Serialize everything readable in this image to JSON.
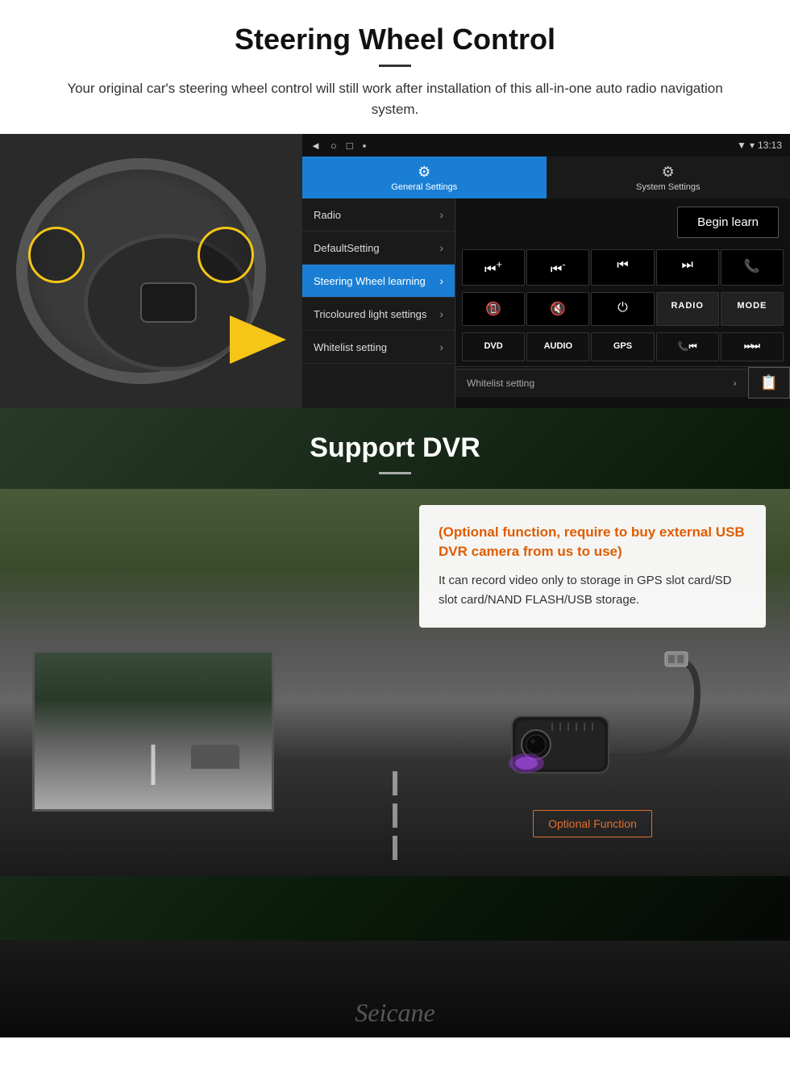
{
  "steering_section": {
    "title": "Steering Wheel Control",
    "description": "Your original car's steering wheel control will still work after installation of this all-in-one auto radio navigation system.",
    "statusbar": {
      "nav_back": "◄",
      "nav_home": "○",
      "nav_recent": "□",
      "nav_menu": "▪",
      "time": "13:13",
      "signal_icon": "▼",
      "wifi_icon": "▾"
    },
    "tabs": {
      "general": {
        "icon": "⚙",
        "label": "General Settings"
      },
      "system": {
        "icon": "⚙",
        "label": "System Settings"
      }
    },
    "menu_items": [
      {
        "label": "Radio",
        "active": false
      },
      {
        "label": "DefaultSetting",
        "active": false
      },
      {
        "label": "Steering Wheel learning",
        "active": true
      },
      {
        "label": "Tricoloured light settings",
        "active": false
      },
      {
        "label": "Whitelist setting",
        "active": false
      }
    ],
    "begin_learn_label": "Begin learn",
    "control_buttons_row1": [
      "⏮+",
      "⏮-",
      "⏮",
      "⏭",
      "📞"
    ],
    "control_buttons_row2": [
      "📵",
      "🔇",
      "⏻",
      "RADIO",
      "MODE"
    ],
    "control_buttons_row3": [
      "DVD",
      "AUDIO",
      "GPS",
      "📞⏮",
      "⏭⏭"
    ]
  },
  "dvr_section": {
    "title": "Support DVR",
    "optional_text": "(Optional function, require to buy external USB DVR camera from us to use)",
    "description": "It can record video only to storage in GPS slot card/SD slot card/NAND FLASH/USB storage.",
    "optional_button": "Optional Function",
    "brand": "Seicane"
  }
}
